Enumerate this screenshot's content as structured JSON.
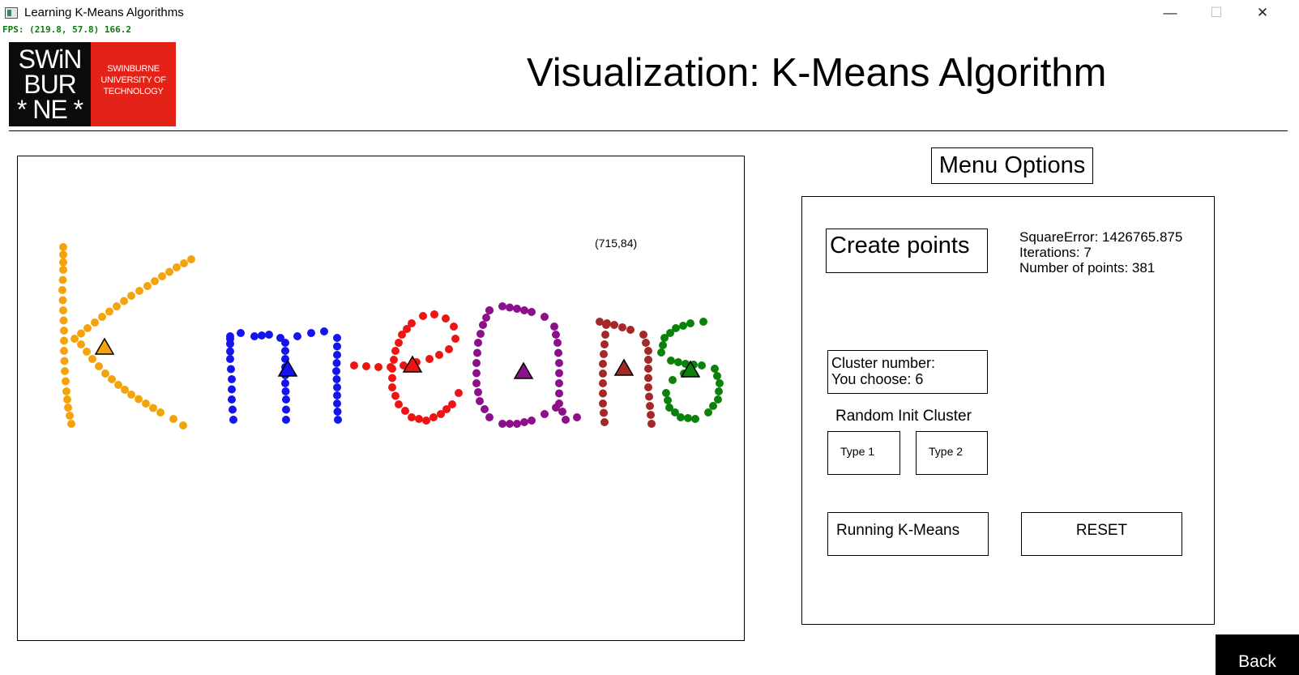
{
  "window": {
    "title": "Learning K-Means Algorithms",
    "fps": "FPS: (219.8, 57.8) 166.2",
    "minimize_glyph": "—",
    "maximize_glyph": "☐",
    "close_glyph": "✕"
  },
  "logo": {
    "line1": "SWiN",
    "line2": "BUR",
    "line3": "* NE *",
    "right_text": "SWINBURNE UNIVERSITY OF TECHNOLOGY",
    "colors": {
      "left": "#0b0b0b",
      "right": "#e42218"
    }
  },
  "header": {
    "title": "Visualization: K-Means Algorithm"
  },
  "plot": {
    "cursor_coords": "(715,84)"
  },
  "menu": {
    "title": "Menu Options",
    "create_points_label": "Create points",
    "stats": {
      "square_error": "SquareError: 1426765.875",
      "iterations": "Iterations: 7",
      "num_points": "Number of points: 381"
    },
    "cluster_label": "Cluster number:",
    "cluster_choice": "You choose: 6",
    "random_init_label": "Random Init Cluster",
    "type1_label": "Type 1",
    "type2_label": "Type 2",
    "run_label": "Running K-Means",
    "reset_label": "RESET"
  },
  "back_label": "Back",
  "chart_data": {
    "type": "scatter",
    "xlim": [
      0,
      898
    ],
    "ylim": [
      0,
      599
    ],
    "series": [
      {
        "color": "#f5a30a",
        "centroid": [
          107,
          236
        ],
        "strokes": [
          [
            [
              56,
              112
            ],
            [
              56,
              140
            ],
            [
              55,
              165
            ],
            [
              56,
              190
            ],
            [
              57,
              215
            ],
            [
              57,
              240
            ],
            [
              58,
              265
            ],
            [
              60,
              290
            ],
            [
              62,
              310
            ],
            [
              66,
              330
            ]
          ],
          [
            [
              214,
              127
            ],
            [
              196,
              137
            ],
            [
              178,
              148
            ],
            [
              160,
              160
            ],
            [
              140,
              172
            ],
            [
              122,
              185
            ],
            [
              104,
              198
            ],
            [
              86,
              212
            ],
            [
              70,
              225
            ]
          ],
          [
            [
              78,
              232
            ],
            [
              92,
              250
            ],
            [
              108,
              268
            ],
            [
              124,
              282
            ],
            [
              140,
              294
            ],
            [
              158,
              305
            ],
            [
              176,
              316
            ],
            [
              192,
              324
            ],
            [
              204,
              332
            ]
          ]
        ]
      },
      {
        "color": "#1414ee",
        "centroid": [
          333,
          263
        ],
        "strokes": [
          [
            [
              262,
              222
            ],
            [
              262,
              250
            ],
            [
              264,
              275
            ],
            [
              264,
              300
            ],
            [
              266,
              325
            ]
          ],
          [
            [
              262,
              225
            ],
            [
              275,
              218
            ],
            [
              292,
              222
            ],
            [
              310,
              220
            ],
            [
              324,
              224
            ],
            [
              330,
              240
            ],
            [
              330,
              260
            ],
            [
              330,
              280
            ],
            [
              331,
              300
            ],
            [
              331,
              325
            ]
          ],
          [
            [
              330,
              230
            ],
            [
              345,
              222
            ],
            [
              362,
              218
            ],
            [
              378,
              216
            ],
            [
              394,
              224
            ],
            [
              394,
              245
            ],
            [
              393,
              265
            ],
            [
              394,
              285
            ],
            [
              394,
              305
            ],
            [
              395,
              325
            ]
          ]
        ]
      },
      {
        "color": "#ee1414",
        "centroid": [
          487,
          258
        ],
        "strokes": [
          [
            [
              415,
              258
            ],
            [
              430,
              259
            ],
            [
              445,
              260
            ],
            [
              460,
              260
            ],
            [
              476,
              258
            ],
            [
              492,
              254
            ],
            [
              508,
              250
            ],
            [
              520,
              245
            ],
            [
              532,
              238
            ],
            [
              540,
              225
            ],
            [
              538,
              210
            ],
            [
              528,
              200
            ],
            [
              514,
              195
            ],
            [
              500,
              197
            ],
            [
              486,
              206
            ],
            [
              474,
              220
            ],
            [
              466,
              240
            ],
            [
              462,
              262
            ],
            [
              462,
              285
            ],
            [
              470,
              306
            ],
            [
              486,
              322
            ],
            [
              504,
              326
            ],
            [
              522,
              318
            ],
            [
              536,
              306
            ],
            [
              544,
              292
            ]
          ]
        ]
      },
      {
        "color": "#8c0f8c",
        "centroid": [
          624,
          266
        ],
        "strokes": [
          [
            [
              582,
              190
            ],
            [
              598,
              185
            ],
            [
              616,
              188
            ],
            [
              634,
              192
            ],
            [
              650,
              198
            ],
            [
              662,
              210
            ],
            [
              666,
              230
            ],
            [
              668,
              255
            ],
            [
              668,
              280
            ],
            [
              668,
              305
            ],
            [
              676,
              325
            ],
            [
              690,
              322
            ]
          ],
          [
            [
              582,
              190
            ],
            [
              574,
              208
            ],
            [
              568,
              230
            ],
            [
              566,
              255
            ],
            [
              566,
              280
            ],
            [
              570,
              302
            ],
            [
              582,
              322
            ],
            [
              598,
              330
            ],
            [
              616,
              330
            ],
            [
              634,
              326
            ],
            [
              650,
              318
            ],
            [
              664,
              310
            ]
          ]
        ]
      },
      {
        "color": "#a52828",
        "centroid": [
          748,
          262
        ],
        "strokes": [
          [
            [
              726,
              208
            ],
            [
              724,
              232
            ],
            [
              722,
              256
            ],
            [
              722,
              280
            ],
            [
              722,
              305
            ],
            [
              724,
              328
            ]
          ],
          [
            [
              718,
              204
            ],
            [
              736,
              208
            ],
            [
              756,
              214
            ],
            [
              772,
              220
            ],
            [
              778,
              240
            ],
            [
              778,
              262
            ],
            [
              778,
              285
            ],
            [
              780,
              308
            ],
            [
              782,
              330
            ]
          ]
        ]
      },
      {
        "color": "#0a820a",
        "centroid": [
          830,
          264
        ],
        "strokes": [
          [
            [
              846,
              204
            ],
            [
              830,
              206
            ],
            [
              812,
              212
            ],
            [
              798,
              224
            ],
            [
              794,
              242
            ],
            [
              806,
              252
            ],
            [
              824,
              256
            ],
            [
              844,
              258
            ],
            [
              860,
              262
            ],
            [
              866,
              280
            ],
            [
              864,
              300
            ],
            [
              852,
              316
            ],
            [
              836,
              324
            ],
            [
              818,
              322
            ],
            [
              804,
              310
            ],
            [
              800,
              292
            ],
            [
              808,
              276
            ],
            [
              822,
              268
            ]
          ]
        ]
      }
    ]
  }
}
